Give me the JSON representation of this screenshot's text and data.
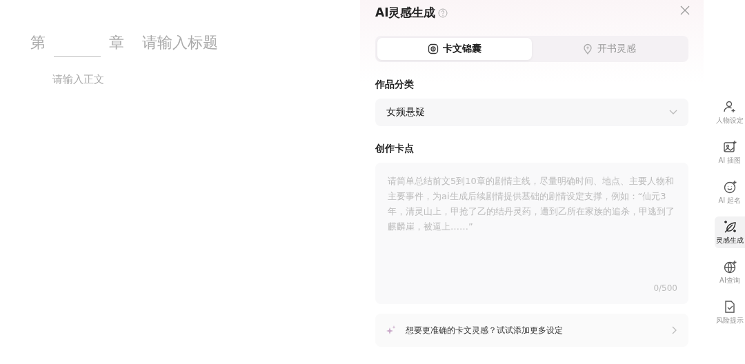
{
  "editor": {
    "chapter_prefix": "第",
    "chapter_suffix": "章",
    "title_placeholder": "请输入标题",
    "body_placeholder": "请输入正文"
  },
  "panel": {
    "title": "AI灵感生成",
    "tabs": [
      {
        "label": "卡文锦囊",
        "kind": "target",
        "selected": true
      },
      {
        "label": "开书灵感",
        "kind": "bulb",
        "selected": false
      }
    ],
    "category_label": "作品分类",
    "category_value": "女频悬疑",
    "points_label": "创作卡点",
    "points_placeholder": "请简单总结前文5到10章的剧情主线，尽量明确时间、地点、主要人物和主要事件，为ai生成后续剧情提供基础的剧情设定支撑，例如：“仙元3年，清灵山上，甲抢了乙的结丹灵药，遭到乙所在家族的追杀，甲逃到了麒麟崖，被逼上……”",
    "counter": "0/500",
    "more_settings": "想要更准确的卡文灵感？试试添加更多设定"
  },
  "sidebar": {
    "items": [
      {
        "label": "人物设定",
        "kind": "person",
        "selected": false
      },
      {
        "label": "AI 插图",
        "kind": "image",
        "selected": false
      },
      {
        "label": "AI 起名",
        "kind": "face",
        "selected": false
      },
      {
        "label": "灵感生成",
        "kind": "feather",
        "selected": true
      },
      {
        "label": "AI查询",
        "kind": "globe",
        "selected": false
      },
      {
        "label": "风险提示",
        "kind": "doc",
        "selected": false
      }
    ]
  }
}
